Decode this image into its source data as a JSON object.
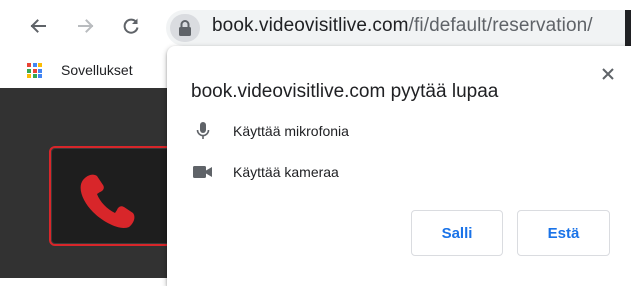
{
  "toolbar": {
    "back_icon": "arrow-back-icon",
    "forward_icon": "arrow-forward-icon",
    "reload_icon": "reload-icon",
    "lock_icon": "lock-icon",
    "url_host": "book.videovisitlive.com",
    "url_path": "/fi/default/reservation/"
  },
  "bookmarks": {
    "apps_icon": "apps-grid-icon",
    "apps_label": "Sovellukset"
  },
  "page": {
    "hangup_icon": "phone-hangup-icon",
    "accent_color": "#d8262a"
  },
  "permission_popup": {
    "title": "book.videovisitlive.com pyytää lupaa",
    "close_icon": "close-icon",
    "permissions": [
      {
        "icon": "microphone-icon",
        "label": "Käyttää mikrofonia"
      },
      {
        "icon": "camera-icon",
        "label": "Käyttää kameraa"
      }
    ],
    "allow_label": "Salli",
    "block_label": "Estä",
    "button_text_color": "#1a73e8"
  }
}
